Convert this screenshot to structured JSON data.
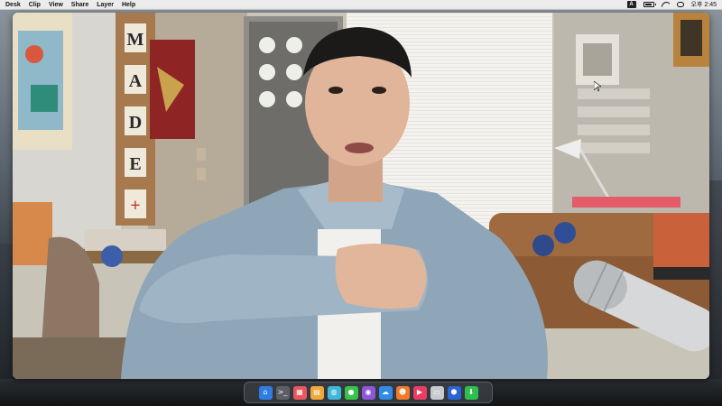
{
  "menubar": {
    "items": [
      "Desk",
      "Clip",
      "View",
      "Share",
      "Layer",
      "Help"
    ],
    "input_badge": "A",
    "clock": "오후 2:45"
  },
  "video": {
    "wall_sign_letters": [
      "M",
      "A",
      "D",
      "E",
      "+"
    ]
  },
  "dock": {
    "apps": [
      {
        "name": "home",
        "icon": "home-icon",
        "color": "#2f7de1",
        "glyph": "⌂"
      },
      {
        "name": "terminal",
        "icon": "terminal-icon",
        "color": "#5b6066",
        "glyph": ">_"
      },
      {
        "name": "calendar",
        "icon": "calendar-icon",
        "color": "#e8575f",
        "glyph": "▦"
      },
      {
        "name": "notes",
        "icon": "notes-icon",
        "color": "#f0a83a",
        "glyph": "▤"
      },
      {
        "name": "messages",
        "icon": "messages-icon",
        "color": "#3fb8d8",
        "glyph": "◍"
      },
      {
        "name": "chat",
        "icon": "chat-icon",
        "color": "#37c24a",
        "glyph": "●"
      },
      {
        "name": "podcasts",
        "icon": "podcast-icon",
        "color": "#8e57d8",
        "glyph": "◉"
      },
      {
        "name": "cloud",
        "icon": "cloud-icon",
        "color": "#2f8be6",
        "glyph": "☁"
      },
      {
        "name": "contacts",
        "icon": "contacts-icon",
        "color": "#f07a2c",
        "glyph": "☻"
      },
      {
        "name": "media",
        "icon": "play-icon",
        "color": "#ee3b62",
        "glyph": "▶"
      },
      {
        "name": "photos",
        "icon": "photo-icon",
        "color": "#c7c9cc",
        "glyph": "▭"
      },
      {
        "name": "security",
        "icon": "shield-icon",
        "color": "#2b64d6",
        "glyph": "⬢"
      },
      {
        "name": "downloads",
        "icon": "download-icon",
        "color": "#2fbf4c",
        "glyph": "⬇"
      }
    ]
  }
}
